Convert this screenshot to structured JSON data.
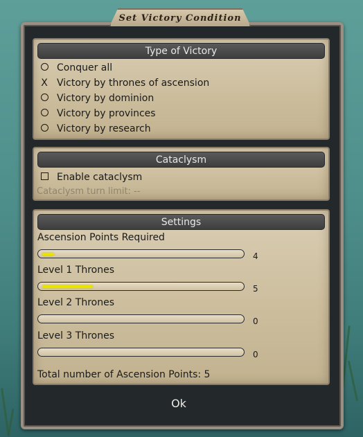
{
  "dialog": {
    "title": "Set Victory Condition",
    "ok_label": "Ok"
  },
  "victory": {
    "header": "Type of Victory",
    "options": [
      {
        "label": "Conquer all",
        "selected": false
      },
      {
        "label": "Victory by thrones of ascension",
        "selected": true
      },
      {
        "label": "Victory by dominion",
        "selected": false
      },
      {
        "label": "Victory by provinces",
        "selected": false
      },
      {
        "label": "Victory by research",
        "selected": false
      }
    ]
  },
  "cataclysm": {
    "header": "Cataclysm",
    "enable_label": "Enable cataclysm",
    "enabled": false,
    "turn_limit_label": "Cataclysm turn limit: --"
  },
  "settings": {
    "header": "Settings",
    "sliders": [
      {
        "label": "Ascension Points Required",
        "value": "4",
        "fill_fraction": 0.06
      },
      {
        "label": "Level 1 Thrones",
        "value": "5",
        "fill_fraction": 0.25
      },
      {
        "label": "Level 2 Thrones",
        "value": "0",
        "fill_fraction": 0
      },
      {
        "label": "Level 3 Thrones",
        "value": "0",
        "fill_fraction": 0
      }
    ],
    "total_label": "Total number of Ascension Points: 5"
  },
  "colors": {
    "slider_fill": "#e8e400",
    "panel_header": "#4a4a4a",
    "frame": "#23292b"
  }
}
